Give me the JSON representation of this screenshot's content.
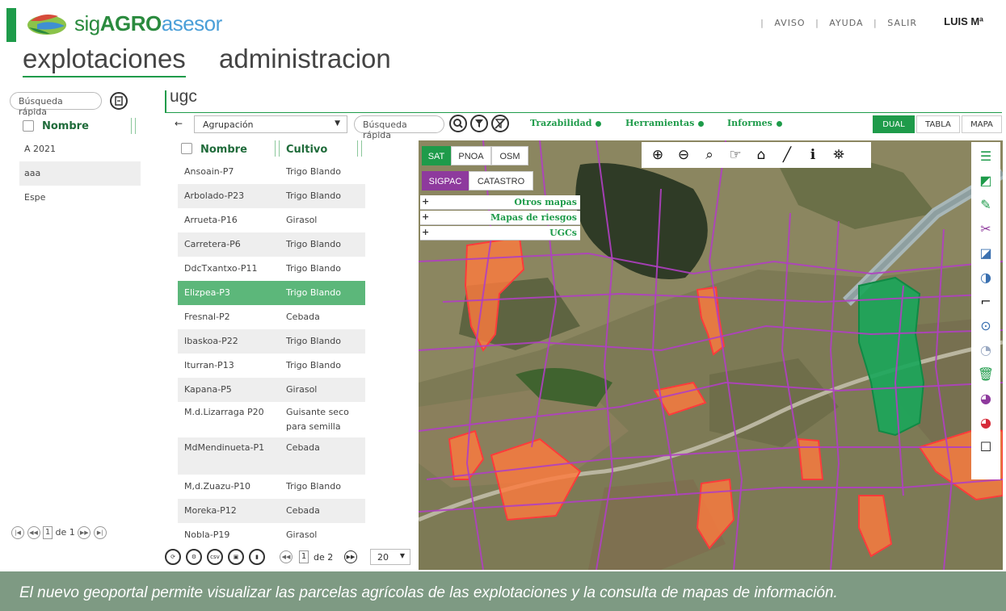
{
  "brand": {
    "part1": "sig",
    "part2": "AGRO",
    "part3": "asesor"
  },
  "topnav": {
    "aviso": "AVISO",
    "ayuda": "AYUDA",
    "salir": "SALIR",
    "sep": "|"
  },
  "user": "LUIS Mª",
  "main_tabs": {
    "explotaciones": "explotaciones",
    "administracion": "administracion"
  },
  "left_panel": {
    "search_placeholder": "Búsqueda rápida",
    "header": "Nombre",
    "items": [
      "A 2021",
      "aaa",
      "Espe"
    ],
    "pager": {
      "current": "1",
      "of_label": "de 1"
    }
  },
  "ugc_title": "ugc",
  "toolbar": {
    "back": "←",
    "grouping": "Agrupación",
    "search_placeholder": "Búsqueda rápida",
    "trazabilidad": "Trazabilidad",
    "herramientas": "Herramientas",
    "informes": "Informes",
    "view_dual": "DUAL",
    "view_tabla": "TABLA",
    "view_mapa": "MAPA"
  },
  "grid": {
    "col_nombre": "Nombre",
    "col_cultivo": "Cultivo",
    "rows": [
      {
        "nombre": "Ansoain-P7",
        "cultivo": "Trigo Blando"
      },
      {
        "nombre": "Arbolado-P23",
        "cultivo": "Trigo Blando"
      },
      {
        "nombre": "Arrueta-P16",
        "cultivo": "Girasol"
      },
      {
        "nombre": "Carretera-P6",
        "cultivo": "Trigo Blando"
      },
      {
        "nombre": "DdcTxantxo-P11",
        "cultivo": "Trigo Blando"
      },
      {
        "nombre": "Elizpea-P3",
        "cultivo": "Trigo Blando"
      },
      {
        "nombre": "Fresnal-P2",
        "cultivo": "Cebada"
      },
      {
        "nombre": "Ibaskoa-P22",
        "cultivo": "Trigo Blando"
      },
      {
        "nombre": "Iturran-P13",
        "cultivo": "Trigo Blando"
      },
      {
        "nombre": "Kapana-P5",
        "cultivo": "Girasol"
      },
      {
        "nombre": "M.d.Lizarraga P20",
        "cultivo": "Guisante seco para semilla"
      },
      {
        "nombre": "MdMendinueta-P1",
        "cultivo": "Cebada"
      },
      {
        "nombre": "M,d.Zuazu-P10",
        "cultivo": "Trigo Blando"
      },
      {
        "nombre": "Moreka-P12",
        "cultivo": "Cebada"
      },
      {
        "nombre": "Nobla-P19",
        "cultivo": "Girasol"
      }
    ],
    "selected_index": 5,
    "pager": {
      "current": "1",
      "of_label": "de 2",
      "page_size": "20",
      "csv": "csv"
    }
  },
  "map": {
    "base_layers": [
      "SAT",
      "PNOA",
      "OSM"
    ],
    "overlay_layers": [
      "SIGPAC",
      "CATASTRO"
    ],
    "layer_groups": [
      "Otros mapas",
      "Mapas de riesgos",
      "UGCs"
    ],
    "plus": "+"
  },
  "caption": "El nuevo geoportal permite visualizar las parcelas agrícolas de las explotaciones y la consulta de mapas de información."
}
